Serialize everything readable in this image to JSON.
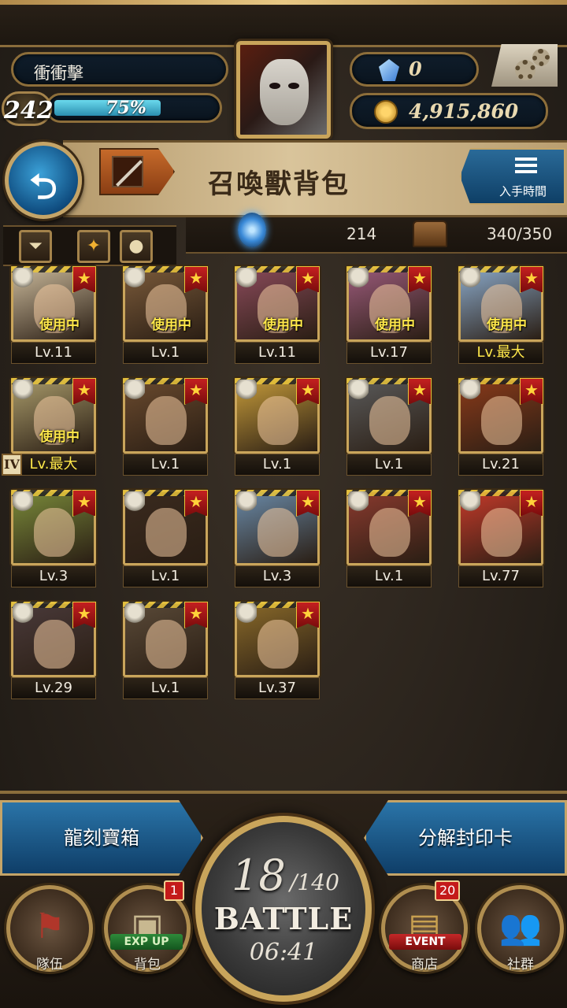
{
  "header": {
    "player_name": "衝衝擊",
    "level": "242",
    "exp_percent_text": "75%",
    "exp_fraction": 0.75,
    "gems": "0",
    "gold": "4,915,860"
  },
  "title_bar": {
    "title": "召喚獸背包",
    "sort_label": "入手時間"
  },
  "inventory": {
    "soul_count": "214",
    "capacity": "340/350"
  },
  "cards": [
    {
      "level": "Lv.11",
      "in_use": "使用中",
      "bg": "#c9b89a"
    },
    {
      "level": "Lv.1",
      "in_use": "使用中",
      "bg": "#7a5a3a"
    },
    {
      "level": "Lv.11",
      "in_use": "使用中",
      "bg": "#8a4a5a"
    },
    {
      "level": "Lv.17",
      "in_use": "使用中",
      "bg": "#9a5a7a"
    },
    {
      "level": "Lv.最大",
      "in_use": "使用中",
      "bg": "#8aa8c8",
      "max": true
    },
    {
      "level": "Lv.最大",
      "in_use": "使用中",
      "bg": "#a89a6a",
      "max": true,
      "rank": "IV"
    },
    {
      "level": "Lv.1",
      "bg": "#6a4a2e"
    },
    {
      "level": "Lv.1",
      "bg": "#c49a3a"
    },
    {
      "level": "Lv.1",
      "bg": "#5a5a5a"
    },
    {
      "level": "Lv.21",
      "bg": "#8a3a1a"
    },
    {
      "level": "Lv.3",
      "bg": "#7a8a3a"
    },
    {
      "level": "Lv.1",
      "bg": "#3a2a1e"
    },
    {
      "level": "Lv.3",
      "bg": "#6a8aa8"
    },
    {
      "level": "Lv.1",
      "bg": "#8a3a2e"
    },
    {
      "level": "Lv.77",
      "bg": "#c43a2a"
    },
    {
      "level": "Lv.29",
      "bg": "#4a3a3a"
    },
    {
      "level": "Lv.1",
      "bg": "#5a4a38"
    },
    {
      "level": "Lv.37",
      "bg": "#8a6a2a"
    }
  ],
  "bottom": {
    "chest_button": "龍刻寶箱",
    "decompose_button": "分解封印卡",
    "battle": {
      "stamina": "18",
      "stamina_max": "/140",
      "label": "BATTLE",
      "timer": "06:41"
    },
    "nav": {
      "team": "隊伍",
      "bag": "背包",
      "bag_tag": "EXP UP",
      "bag_badge": "1",
      "shop": "商店",
      "shop_tag": "EVENT",
      "shop_badge": "20",
      "social": "社群"
    }
  }
}
